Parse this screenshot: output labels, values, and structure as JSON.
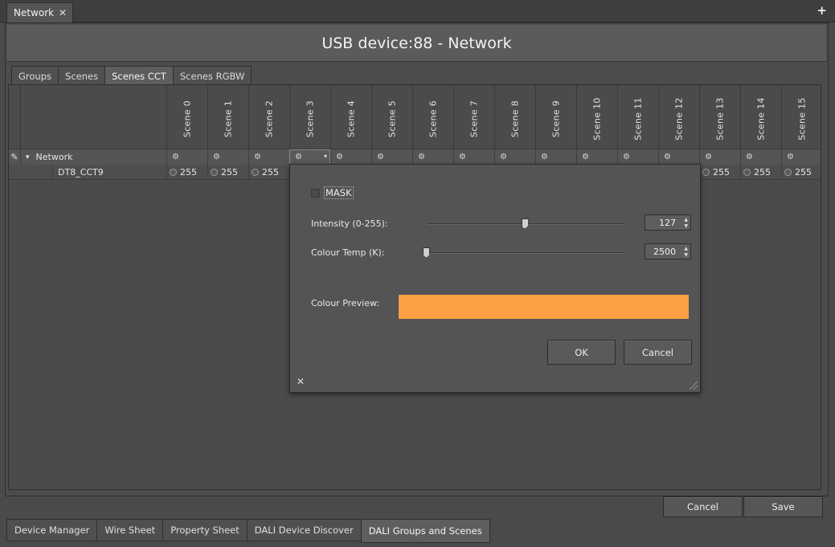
{
  "document_tab": {
    "label": "Network",
    "close": "✕"
  },
  "new_tab": "+",
  "title": "USB device:88 - Network",
  "subtabs": [
    {
      "label": "Groups"
    },
    {
      "label": "Scenes"
    },
    {
      "label": "Scenes CCT",
      "active": true
    },
    {
      "label": "Scenes RGBW"
    }
  ],
  "scenes": [
    "Scene 0",
    "Scene 1",
    "Scene 2",
    "Scene 3",
    "Scene 4",
    "Scene 5",
    "Scene 6",
    "Scene 7",
    "Scene 8",
    "Scene 9",
    "Scene 10",
    "Scene 11",
    "Scene 12",
    "Scene 13",
    "Scene 14",
    "Scene 15"
  ],
  "tree": {
    "root": "Network",
    "child": "DT8_CCT9",
    "icons": {
      "edit": "pencil-icon",
      "expand": "caret-down-icon",
      "scene": "gear-icon",
      "radio": "radio-icon"
    },
    "glyphs": {
      "edit": "✎",
      "expand": "▾",
      "gear": "⚙",
      "dropdown": "▾"
    }
  },
  "device_values": [
    "255",
    "255",
    "255",
    "",
    "",
    "",
    "",
    "",
    "",
    "",
    "",
    "",
    "",
    "255",
    "255",
    "255"
  ],
  "popup": {
    "mask_label": "MASK",
    "intensity_label": "Intensity (0-255):",
    "intensity_value": "127",
    "intensity_fraction": 0.498,
    "colour_temp_label": "Colour Temp (K):",
    "colour_temp_value": "2500",
    "colour_temp_fraction": 0.0,
    "preview_label": "Colour Preview:",
    "preview_color": "#fd9f45",
    "ok_label": "OK",
    "cancel_label": "Cancel",
    "close_glyph": "✕",
    "spin_up": "▲",
    "spin_down": "▼"
  },
  "footer": {
    "cancel_label": "Cancel",
    "save_label": "Save"
  },
  "view_tabs": [
    {
      "label": "Device Manager"
    },
    {
      "label": "Wire Sheet"
    },
    {
      "label": "Property Sheet"
    },
    {
      "label": "DALI Device Discover"
    },
    {
      "label": "DALI Groups and Scenes",
      "active": true
    }
  ]
}
